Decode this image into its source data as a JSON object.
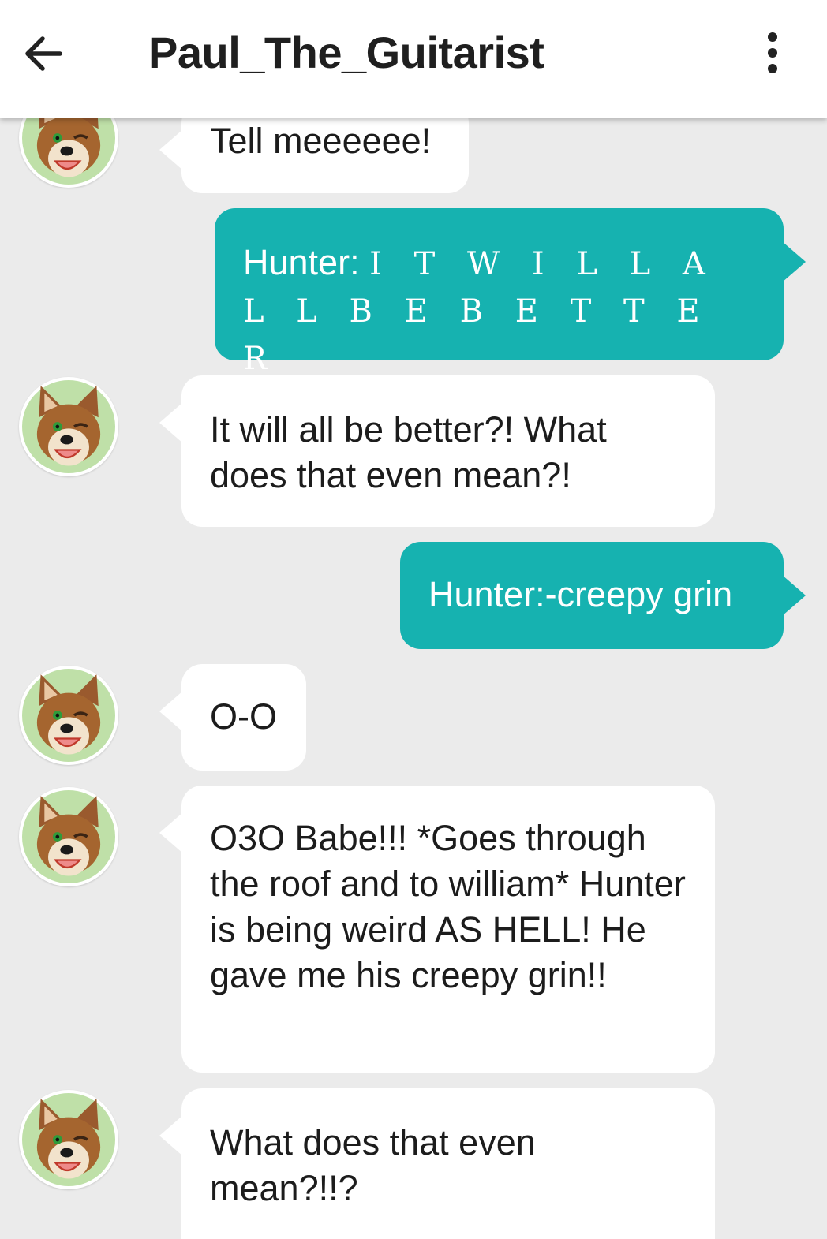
{
  "header": {
    "title": "Paul_The_Guitarist",
    "back_icon": "arrow-left-icon",
    "menu_icon": "more-vertical-icon"
  },
  "colors": {
    "outgoing_bubble": "#16b2b0",
    "incoming_bubble": "#ffffff",
    "background": "#ebebeb"
  },
  "messages": [
    {
      "sender": "other",
      "text": "Tell meeeeee!"
    },
    {
      "sender": "me",
      "prefix": "Hunter: ",
      "text": "I T W I L L A L L B E B E T T E R"
    },
    {
      "sender": "other",
      "text": "It will all be better?! What does that even mean?!"
    },
    {
      "sender": "me",
      "text": "Hunter:-creepy grin"
    },
    {
      "sender": "other",
      "text": "O-O"
    },
    {
      "sender": "other",
      "text": "O3O Babe!!! *Goes through the roof and to william* Hunter is being weird AS HELL! He gave me his creepy grin!!"
    },
    {
      "sender": "other",
      "text": "What does that even mean?!!?"
    }
  ]
}
